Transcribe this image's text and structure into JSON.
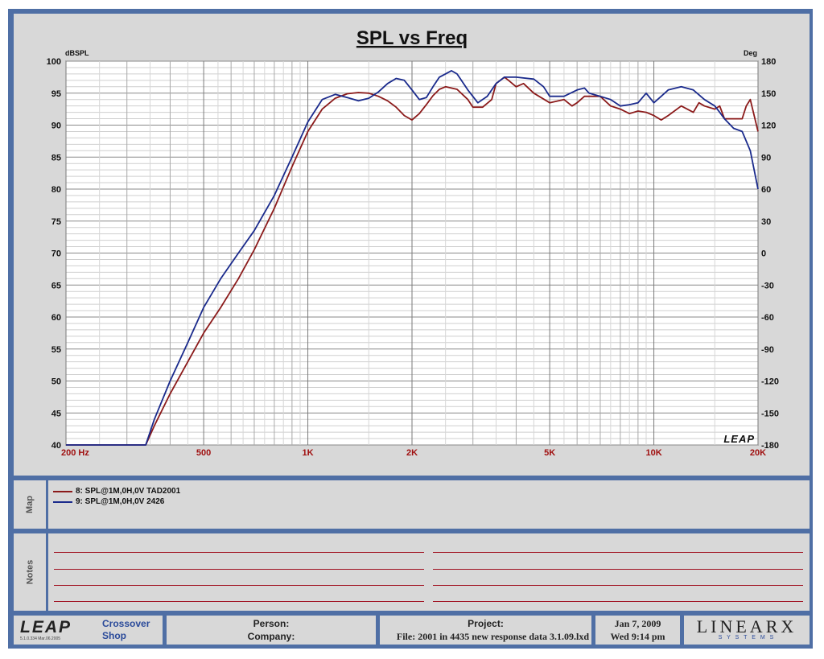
{
  "chart_data": {
    "type": "line",
    "title": "SPL vs Freq",
    "y_left_label": "dBSPL",
    "y_right_label": "Deg",
    "x_scale": "log",
    "x_range": [
      200,
      20000
    ],
    "y_left_range": [
      40,
      100
    ],
    "y_right_range": [
      -180,
      180
    ],
    "grid": true,
    "x_tick_labels": [
      {
        "v": 200,
        "t": "200  Hz"
      },
      {
        "v": 500,
        "t": "500"
      },
      {
        "v": 1000,
        "t": "1K"
      },
      {
        "v": 2000,
        "t": "2K"
      },
      {
        "v": 5000,
        "t": "5K"
      },
      {
        "v": 10000,
        "t": "10K"
      },
      {
        "v": 20000,
        "t": "20K"
      }
    ],
    "y_left_ticks": [
      40,
      45,
      50,
      55,
      60,
      65,
      70,
      75,
      80,
      85,
      90,
      95,
      100
    ],
    "y_right_ticks": [
      -180,
      -150,
      -120,
      -90,
      -60,
      -30,
      0,
      30,
      60,
      90,
      120,
      150,
      180
    ],
    "watermark": "LEAP",
    "series": [
      {
        "name": "8: SPL@1M,0H,0V TAD2001",
        "color": "#8b1a1a",
        "x": [
          200,
          340,
          360,
          400,
          450,
          500,
          560,
          630,
          700,
          800,
          900,
          1000,
          1100,
          1200,
          1300,
          1400,
          1500,
          1600,
          1700,
          1800,
          1900,
          2000,
          2100,
          2200,
          2300,
          2400,
          2500,
          2700,
          2900,
          3000,
          3200,
          3400,
          3500,
          3700,
          3800,
          4000,
          4200,
          4500,
          5000,
          5500,
          5800,
          6000,
          6300,
          6600,
          7000,
          7500,
          8000,
          8500,
          9000,
          9500,
          10000,
          10500,
          11000,
          12000,
          13000,
          13500,
          14000,
          15000,
          15500,
          16000,
          17000,
          18000,
          18500,
          19000,
          20000
        ],
        "y": [
          40,
          40,
          43,
          48,
          53,
          57.5,
          61.5,
          66,
          70.5,
          77,
          83.5,
          89,
          92.5,
          94.2,
          94.9,
          95.1,
          95.0,
          94.5,
          93.8,
          92.8,
          91.5,
          90.8,
          91.8,
          93.2,
          94.6,
          95.6,
          96.0,
          95.6,
          94,
          92.8,
          92.8,
          94,
          96.5,
          97.5,
          97,
          96,
          96.5,
          95,
          93.5,
          94,
          93,
          93.5,
          94.5,
          94.5,
          94.5,
          93,
          92.5,
          91.8,
          92.2,
          92,
          91.5,
          90.8,
          91.5,
          93,
          92,
          93.5,
          93,
          92.5,
          93,
          91,
          91,
          91,
          93,
          94,
          89
        ]
      },
      {
        "name": "9: SPL@1M,0H,0V 2426",
        "color": "#1a2a8c",
        "x": [
          200,
          340,
          360,
          400,
          450,
          500,
          560,
          630,
          700,
          800,
          900,
          1000,
          1100,
          1200,
          1300,
          1400,
          1500,
          1600,
          1700,
          1800,
          1900,
          2000,
          2100,
          2200,
          2300,
          2400,
          2600,
          2700,
          2900,
          3100,
          3300,
          3500,
          3700,
          3800,
          4000,
          4500,
          4800,
          5000,
          5500,
          6000,
          6300,
          6500,
          7000,
          7500,
          8000,
          8500,
          9000,
          9500,
          10000,
          10500,
          11000,
          12000,
          13000,
          14000,
          15000,
          15500,
          16000,
          17000,
          18000,
          19000,
          20000
        ],
        "y": [
          40,
          40,
          44,
          50,
          56,
          61.5,
          66,
          70,
          73.5,
          79,
          85,
          90.5,
          94,
          94.8,
          94.3,
          93.8,
          94.2,
          95.2,
          96.5,
          97.3,
          97,
          95.5,
          94,
          94.3,
          96,
          97.5,
          98.5,
          98,
          95.5,
          93.5,
          94.5,
          96.5,
          97.5,
          97.5,
          97.5,
          97.2,
          96,
          94.5,
          94.5,
          95.5,
          95.8,
          95,
          94.5,
          94,
          93,
          93.2,
          93.5,
          95,
          93.5,
          94.5,
          95.5,
          96,
          95.5,
          94,
          93,
          92,
          91,
          89.5,
          89,
          86,
          80
        ]
      }
    ]
  },
  "map": {
    "label": "Map",
    "items": [
      {
        "label": "8: SPL@1M,0H,0V TAD2001",
        "color": "#8b1a1a"
      },
      {
        "label": "9: SPL@1M,0H,0V 2426",
        "color": "#1a2a8c"
      }
    ]
  },
  "notes": {
    "label": "Notes"
  },
  "footer": {
    "logo": "LEAP",
    "logo_version": "5.1.0.334  Mar.06.2005",
    "app_line1": "Crossover",
    "app_line2": "Shop",
    "person_label": "Person:",
    "company_label": "Company:",
    "project_label": "Project:",
    "file_text": "File: 2001 in 4435 new response data 3.1.09.lxd",
    "date": "Jan  7, 2009",
    "day_time": "Wed  9:14 pm",
    "brand": "LINEARX",
    "brand_sub": "S Y S T E M S"
  }
}
